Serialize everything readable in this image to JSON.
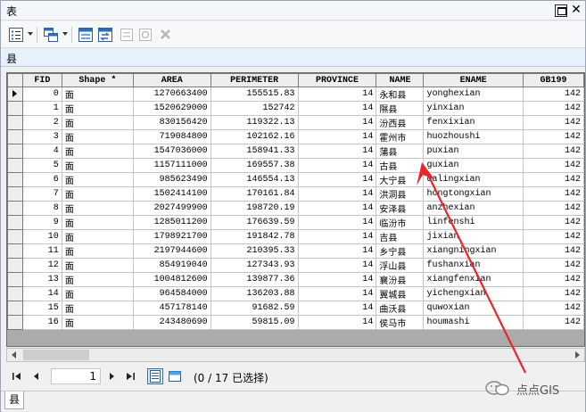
{
  "window": {
    "title": "表"
  },
  "toolbar": {
    "icons": [
      "table-options-icon",
      "related-tables-icon",
      "select-by-attributes-icon",
      "switch-selection-icon",
      "clear-selection-icon",
      "zoom-to-selected-icon",
      "delete-selected-icon"
    ]
  },
  "tab": {
    "label": "县"
  },
  "table": {
    "columns": [
      "FID",
      "Shape *",
      "AREA",
      "PERIMETER",
      "PROVINCE",
      "NAME",
      "ENAME",
      "GB199"
    ],
    "rows": [
      [
        "0",
        "面",
        "1270663400",
        "155515.83",
        "14",
        "永和县",
        "yonghexian",
        "142"
      ],
      [
        "1",
        "面",
        "1520629000",
        "152742",
        "14",
        "隰县",
        "yinxian",
        "142"
      ],
      [
        "2",
        "面",
        "830156420",
        "119322.13",
        "14",
        "汾西县",
        "fenxixian",
        "142"
      ],
      [
        "3",
        "面",
        "719084800",
        "102162.16",
        "14",
        "霍州市",
        "huozhoushi",
        "142"
      ],
      [
        "4",
        "面",
        "1547036000",
        "158941.33",
        "14",
        "蒲县",
        "puxian",
        "142"
      ],
      [
        "5",
        "面",
        "1157111000",
        "169557.38",
        "14",
        "古县",
        "guxian",
        "142"
      ],
      [
        "6",
        "面",
        "985623490",
        "146554.13",
        "14",
        "大宁县",
        "dalingxian",
        "142"
      ],
      [
        "7",
        "面",
        "1502414100",
        "170161.84",
        "14",
        "洪洞县",
        "hongtongxian",
        "142"
      ],
      [
        "8",
        "面",
        "2027499900",
        "198720.19",
        "14",
        "安泽县",
        "anzhexian",
        "142"
      ],
      [
        "9",
        "面",
        "1285011200",
        "176639.59",
        "14",
        "临汾市",
        "linfenshi",
        "142"
      ],
      [
        "10",
        "面",
        "1798921700",
        "191842.78",
        "14",
        "吉县",
        "jixian",
        "142"
      ],
      [
        "11",
        "面",
        "2197944600",
        "210395.33",
        "14",
        "乡宁县",
        "xiangningxian",
        "142"
      ],
      [
        "12",
        "面",
        "854919040",
        "127343.93",
        "14",
        "浮山县",
        "fushanxian",
        "142"
      ],
      [
        "13",
        "面",
        "1004812600",
        "139877.36",
        "14",
        "襄汾县",
        "xiangfenxian",
        "142"
      ],
      [
        "14",
        "面",
        "964584000",
        "136203.88",
        "14",
        "翼城县",
        "yichengxian",
        "142"
      ],
      [
        "15",
        "面",
        "457178140",
        "91682.59",
        "14",
        "曲沃县",
        "quwoxian",
        "142"
      ],
      [
        "16",
        "面",
        "243480690",
        "59815.09",
        "14",
        "侯马市",
        "houmashi",
        "142"
      ]
    ]
  },
  "status": {
    "page": "1",
    "selection_text": "(0 / 17 已选择)"
  },
  "bottom_tab": {
    "label": "县"
  },
  "watermark": {
    "text": "点点GIS"
  },
  "colors": {
    "annotation_arrow": "#e8262c",
    "header_bg": "#eeeeee",
    "grid_bg": "#ababab"
  }
}
